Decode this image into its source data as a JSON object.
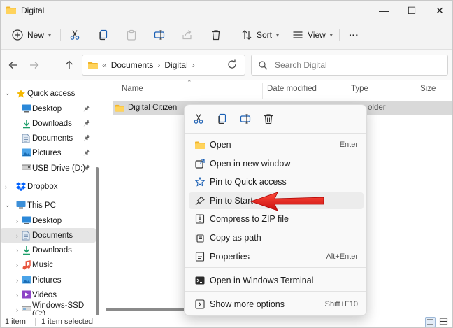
{
  "window": {
    "title": "Digital",
    "controls": {
      "minimize": "—",
      "maximize": "☐",
      "close": "✕"
    }
  },
  "toolbar": {
    "new_label": "New",
    "sort_label": "Sort",
    "view_label": "View",
    "more_label": "···"
  },
  "address_bar": {
    "overflow": "«",
    "crumbs": [
      "Documents",
      "Digital"
    ],
    "separator": "›",
    "search_placeholder": "Search Digital"
  },
  "nav_pane": {
    "items": [
      {
        "label": "Quick access",
        "icon": "star-icon",
        "level": 0,
        "expanded": true,
        "pinned": false
      },
      {
        "label": "Desktop",
        "icon": "desktop-icon",
        "level": 1,
        "pinned": true
      },
      {
        "label": "Downloads",
        "icon": "download-icon",
        "level": 1,
        "pinned": true
      },
      {
        "label": "Documents",
        "icon": "documents-icon",
        "level": 1,
        "pinned": true
      },
      {
        "label": "Pictures",
        "icon": "pictures-icon",
        "level": 1,
        "pinned": true
      },
      {
        "label": "USB Drive (D:)",
        "icon": "usb-drive-icon",
        "level": 1,
        "pinned": true
      },
      {
        "label": "Dropbox",
        "icon": "dropbox-icon",
        "level": 0,
        "expanded": false
      },
      {
        "label": "This PC",
        "icon": "computer-icon",
        "level": 0,
        "expanded": true
      },
      {
        "label": "Desktop",
        "icon": "desktop-icon",
        "level": 1
      },
      {
        "label": "Documents",
        "icon": "documents-icon",
        "level": 1,
        "selected": true
      },
      {
        "label": "Downloads",
        "icon": "download-icon",
        "level": 1
      },
      {
        "label": "Music",
        "icon": "music-icon",
        "level": 1
      },
      {
        "label": "Pictures",
        "icon": "pictures-icon",
        "level": 1
      },
      {
        "label": "Videos",
        "icon": "videos-icon",
        "level": 1
      },
      {
        "label": "Windows-SSD (C:)",
        "icon": "drive-icon",
        "level": 1
      }
    ]
  },
  "content": {
    "columns": [
      "Name",
      "Date modified",
      "Type",
      "Size"
    ],
    "files": [
      {
        "name": "Digital Citizen",
        "type_partial": "older"
      }
    ]
  },
  "context_menu": {
    "items": [
      {
        "label": "Open",
        "shortcut": "Enter",
        "icon": "folder-icon"
      },
      {
        "label": "Open in new window",
        "shortcut": "",
        "icon": "new-window-icon"
      },
      {
        "label": "Pin to Quick access",
        "shortcut": "",
        "icon": "star-outline-icon"
      },
      {
        "label": "Pin to Start",
        "shortcut": "",
        "icon": "pin-icon",
        "highlighted": true
      },
      {
        "label": "Compress to ZIP file",
        "shortcut": "",
        "icon": "zip-icon"
      },
      {
        "label": "Copy as path",
        "shortcut": "",
        "icon": "copy-path-icon"
      },
      {
        "label": "Properties",
        "shortcut": "Alt+Enter",
        "icon": "properties-icon"
      },
      {
        "label": "Open in Windows Terminal",
        "shortcut": "",
        "icon": "terminal-icon"
      },
      {
        "label": "Show more options",
        "shortcut": "Shift+F10",
        "icon": "more-options-icon"
      }
    ]
  },
  "status_bar": {
    "item_count": "1 item",
    "selection": "1 item selected"
  },
  "colors": {
    "accent": "#0067c0",
    "folder": "#f7c948",
    "arrow": "#e02020",
    "selection": "#d9d9d9"
  }
}
